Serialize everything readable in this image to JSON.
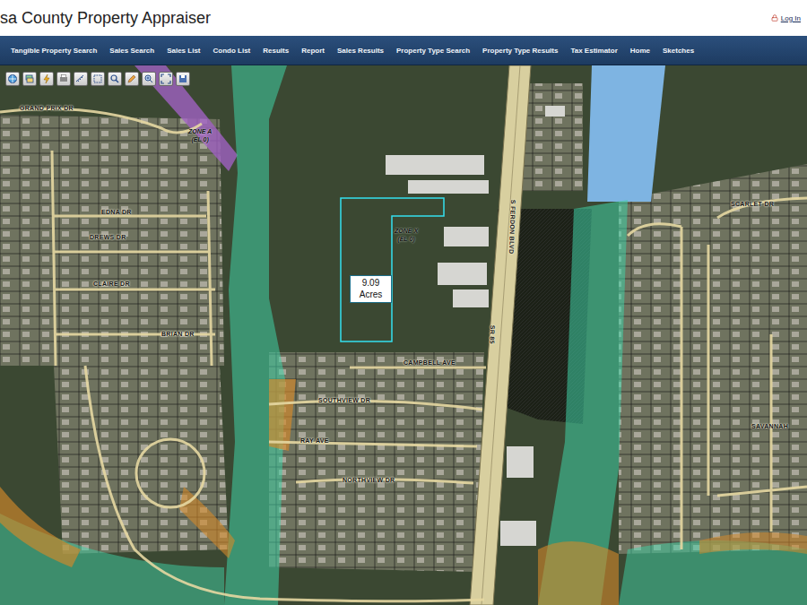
{
  "header": {
    "title": "sa County Property Appraiser",
    "login": "Log In"
  },
  "nav": {
    "items": [
      "Tangible Property Search",
      "Sales Search",
      "Sales List",
      "Condo List",
      "Results",
      "Report",
      "Sales Results",
      "Property Type Search",
      "Property Type Results",
      "Tax Estimator",
      "Home",
      "Sketches"
    ]
  },
  "map": {
    "zones": [
      {
        "name": "ZONE A",
        "elevation": "(EL 0)"
      },
      {
        "name": "ZONE X",
        "elevation": "(EL 0)"
      }
    ],
    "parcel": {
      "area": "9.09",
      "unit": "Acres",
      "selected": true
    },
    "streets": [
      "GRAND PRIX DR",
      "EDNA DR",
      "DREWS DR",
      "CLAIRE DR",
      "BRIAN DR",
      "CAMPBELL AVE",
      "SOUTHVIEW DR",
      "RAY AVE",
      "NORTHVIEW DR",
      "S FERDON BLVD",
      "SR 85",
      "SCARLET DR",
      "SAVANNAH"
    ]
  }
}
